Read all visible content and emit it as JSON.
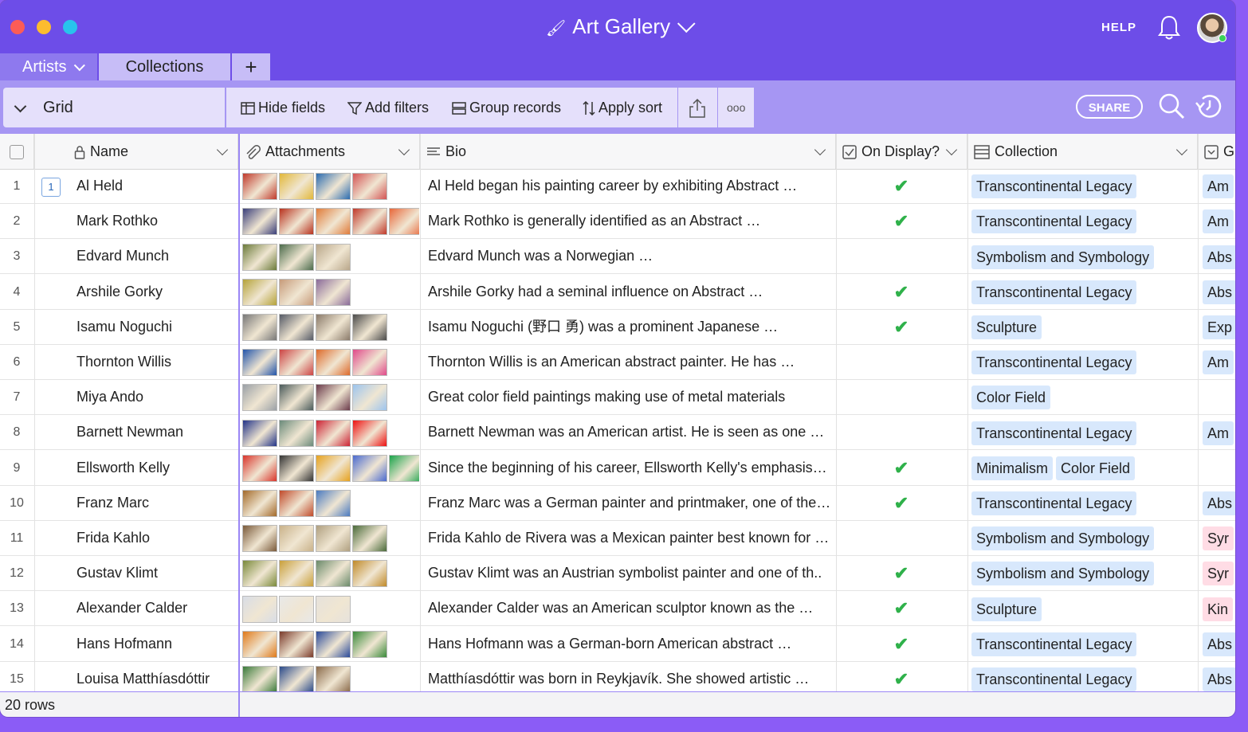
{
  "app": {
    "title": "Art Gallery",
    "help_label": "HELP",
    "share_label": "SHARE"
  },
  "tabs": [
    {
      "label": "Artists",
      "active": true
    },
    {
      "label": "Collections",
      "active": false
    }
  ],
  "add_tab_label": "+",
  "toolbar": {
    "view_label": "Grid",
    "hide_fields": "Hide fields",
    "add_filters": "Add filters",
    "group_records": "Group records",
    "apply_sort": "Apply sort",
    "more_label": "ooo"
  },
  "columns": {
    "name": "Name",
    "attachments": "Attachments",
    "bio": "Bio",
    "on_display": "On Display?",
    "collection": "Collection",
    "extra": "G"
  },
  "colors": {
    "accent": "#6d4de8",
    "tab_bg": "#c7bdf7",
    "toolbar_bg": "#a696f3",
    "check": "#2fb14a",
    "pill_blue": "#d8e8fc",
    "pill_pink": "#ffdce5"
  },
  "rows": [
    {
      "num": "1",
      "name": "Al Held",
      "comments": "1",
      "bio": "Al Held began his painting career by exhibiting Abstract …",
      "on_display": true,
      "collections": [
        "Transcontinental Legacy"
      ],
      "extra": "Am",
      "extra_color": "blue",
      "thumbs": [
        "#c0392b",
        "#e2b83a",
        "#2b6cb0",
        "#d35454"
      ]
    },
    {
      "num": "2",
      "name": "Mark Rothko",
      "bio": "Mark Rothko is generally identified as an Abstract …",
      "on_display": true,
      "collections": [
        "Transcontinental Legacy"
      ],
      "extra": "Am",
      "extra_color": "blue",
      "thumbs": [
        "#3a3f7a",
        "#b8321e",
        "#e07b39",
        "#c0392b",
        "#e8673a"
      ]
    },
    {
      "num": "3",
      "name": "Edvard Munch",
      "bio": "Edvard Munch was a Norwegian …",
      "on_display": false,
      "collections": [
        "Symbolism and Symbology"
      ],
      "extra": "Abs",
      "extra_color": "blue",
      "thumbs": [
        "#6b7a3a",
        "#4b6b4b",
        "#b9a78a"
      ]
    },
    {
      "num": "4",
      "name": "Arshile Gorky",
      "bio": "Arshile Gorky had a seminal influence on Abstract …",
      "on_display": true,
      "collections": [
        "Transcontinental Legacy"
      ],
      "extra": "Abs",
      "extra_color": "blue",
      "thumbs": [
        "#b5a33a",
        "#c79b7a",
        "#8a6b9a"
      ]
    },
    {
      "num": "5",
      "name": "Isamu Noguchi",
      "bio": "Isamu Noguchi (野口 勇) was a prominent Japanese …",
      "on_display": true,
      "collections": [
        "Sculpture"
      ],
      "extra": "Exp",
      "extra_color": "blue",
      "thumbs": [
        "#777777",
        "#555a66",
        "#8a7a6a",
        "#4a4a4a"
      ]
    },
    {
      "num": "6",
      "name": "Thornton Willis",
      "bio": "Thornton Willis is an American abstract painter. He has …",
      "on_display": false,
      "collections": [
        "Transcontinental Legacy"
      ],
      "extra": "Am",
      "extra_color": "blue",
      "thumbs": [
        "#2255aa",
        "#cc4444",
        "#dd6a2a",
        "#e04a8a"
      ]
    },
    {
      "num": "7",
      "name": "Miya Ando",
      "bio": "Great color field paintings making use of metal materials",
      "on_display": false,
      "collections": [
        "Color Field"
      ],
      "extra": "",
      "extra_color": "blue",
      "thumbs": [
        "#9aa0a6",
        "#4a5a5a",
        "#6a3a4a",
        "#9cc4ee"
      ]
    },
    {
      "num": "8",
      "name": "Barnett Newman",
      "bio": "Barnett Newman was an American artist. He is seen as one …",
      "on_display": false,
      "collections": [
        "Transcontinental Legacy"
      ],
      "extra": "Am",
      "extra_color": "blue",
      "thumbs": [
        "#223388",
        "#6a8a7a",
        "#cc2233",
        "#ee1111"
      ]
    },
    {
      "num": "9",
      "name": "Ellsworth Kelly",
      "bio": "Since the beginning of his career, Ellsworth Kelly's emphasis…",
      "on_display": true,
      "collections": [
        "Minimalism",
        "Color Field"
      ],
      "extra": "",
      "extra_color": "blue",
      "thumbs": [
        "#d9342b",
        "#333333",
        "#e6a21e",
        "#4a6ad0",
        "#1aa34a"
      ]
    },
    {
      "num": "10",
      "name": "Franz Marc",
      "bio": "Franz Marc was a German painter and printmaker, one of the…",
      "on_display": true,
      "collections": [
        "Transcontinental Legacy"
      ],
      "extra": "Abs",
      "extra_color": "blue",
      "thumbs": [
        "#a36a2a",
        "#c04a2a",
        "#4a7ac0"
      ]
    },
    {
      "num": "11",
      "name": "Frida Kahlo",
      "bio": "Frida Kahlo de Rivera was a Mexican painter best known for …",
      "on_display": false,
      "collections": [
        "Symbolism and Symbology"
      ],
      "extra": "Syr",
      "extra_color": "pink",
      "thumbs": [
        "#7a5a3a",
        "#c9b28a",
        "#b0a080",
        "#4a6a3a"
      ]
    },
    {
      "num": "12",
      "name": "Gustav Klimt",
      "bio": "Gustav Klimt was an Austrian symbolist painter and one of th..",
      "on_display": true,
      "collections": [
        "Symbolism and Symbology"
      ],
      "extra": "Syr",
      "extra_color": "pink",
      "thumbs": [
        "#7a8a3a",
        "#c9a03a",
        "#6a8a6a",
        "#c08a2a"
      ]
    },
    {
      "num": "13",
      "name": "Alexander Calder",
      "bio": "Alexander Calder was an American sculptor known as the …",
      "on_display": true,
      "collections": [
        "Sculpture"
      ],
      "extra": "Kin",
      "extra_color": "pink",
      "thumbs": [
        "#d8dde6",
        "#e8e8e8",
        "#e6e2dc"
      ]
    },
    {
      "num": "14",
      "name": "Hans Hofmann",
      "bio": "Hans Hofmann was a German-born American abstract …",
      "on_display": true,
      "collections": [
        "Transcontinental Legacy"
      ],
      "extra": "Abs",
      "extra_color": "blue",
      "thumbs": [
        "#e07a1a",
        "#7a3a2a",
        "#2a4a9a",
        "#3a8a3a"
      ]
    },
    {
      "num": "15",
      "name": "Louisa Matthíasdóttir",
      "bio": "Matthíasdóttir was born in Reykjavík. She showed artistic …",
      "on_display": true,
      "collections": [
        "Transcontinental Legacy"
      ],
      "extra": "Abs",
      "extra_color": "blue",
      "thumbs": [
        "#3a7a3a",
        "#2a4a8a",
        "#8a6a4a"
      ]
    }
  ],
  "footer": {
    "row_count": "20 rows"
  }
}
